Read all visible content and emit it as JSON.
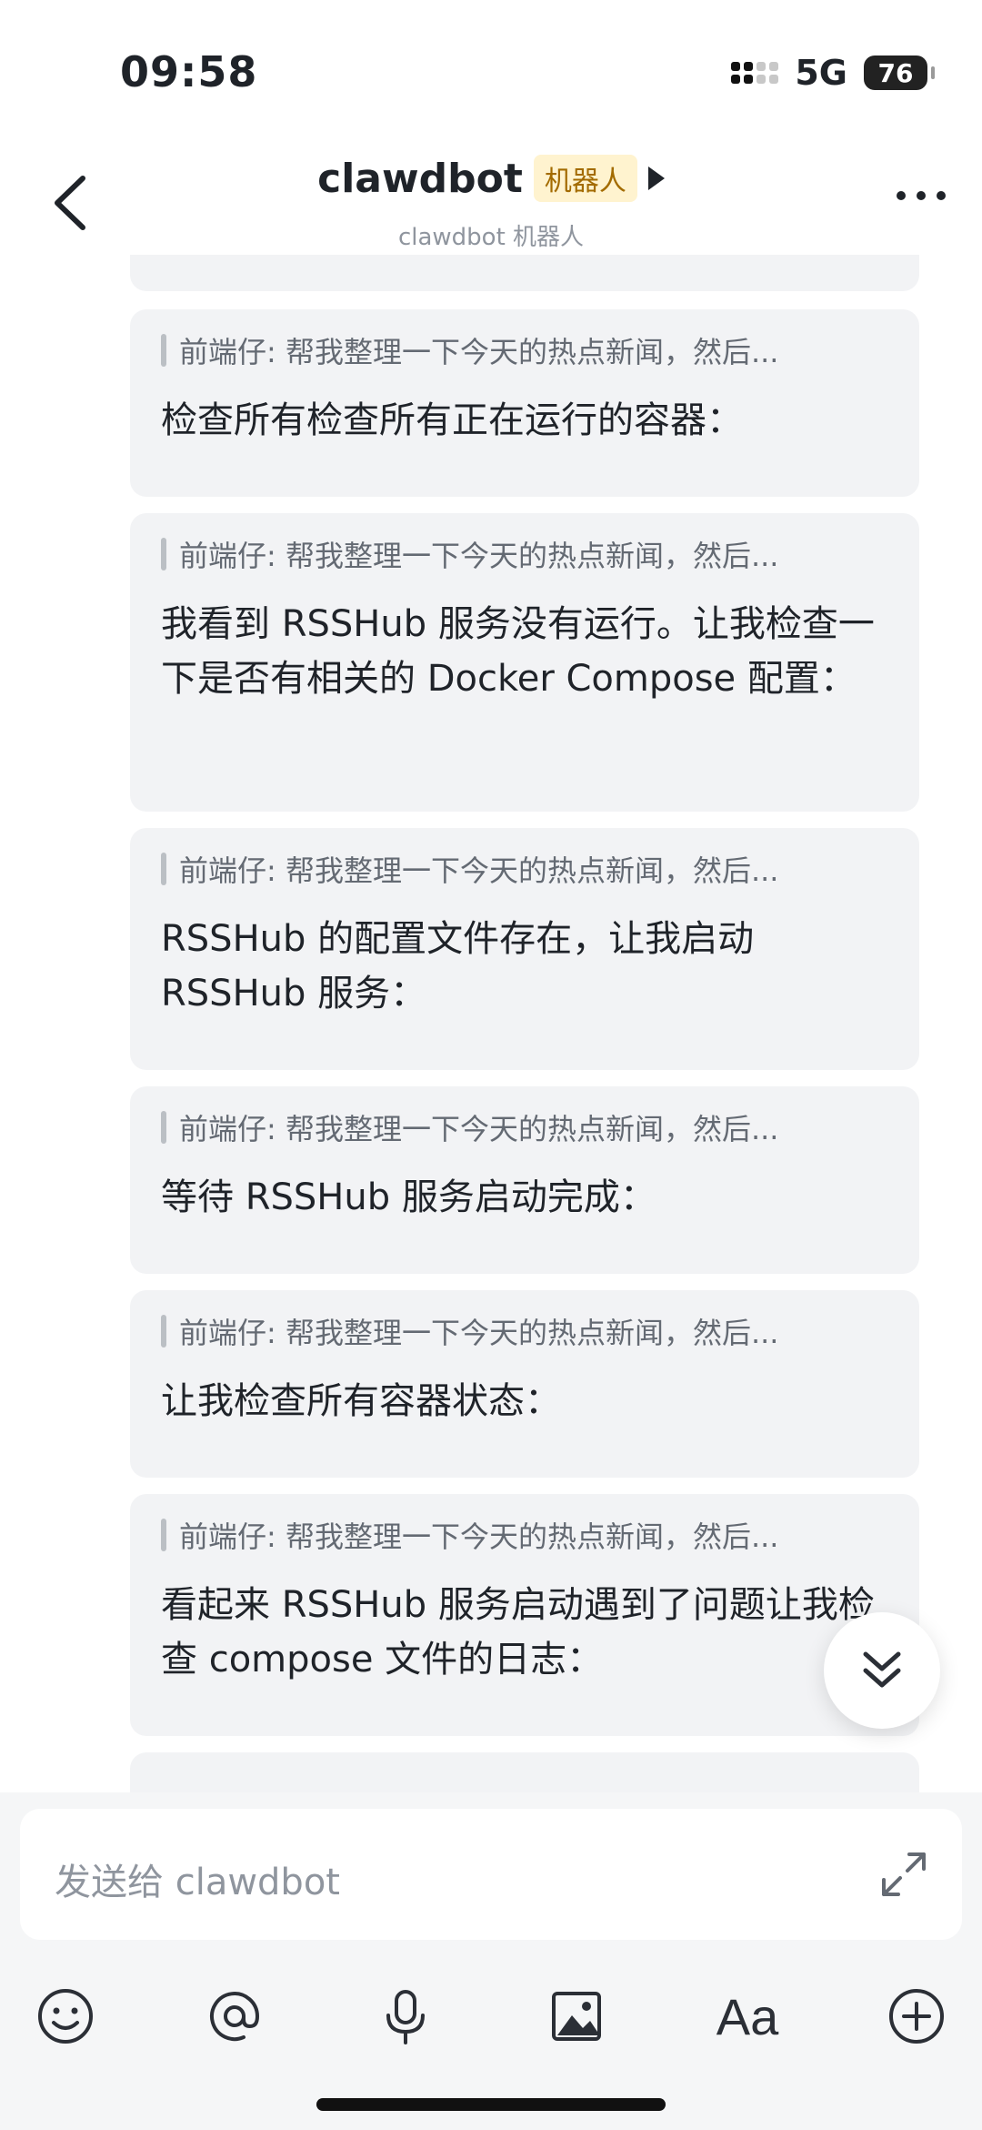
{
  "status": {
    "time": "09:58",
    "network": "5G",
    "battery": "76"
  },
  "header": {
    "title": "clawdbot",
    "badge": "机器人",
    "subtitle": "clawdbot 机器人"
  },
  "messages": [
    {
      "quote": "前端仔: 帮我整理一下今天的热点新闻，然后...",
      "text": "检查所有检查所有正在运行的容器："
    },
    {
      "quote": "前端仔: 帮我整理一下今天的热点新闻，然后...",
      "text": "我看到 RSSHub 服务没有运行。让我检查一下是否有相关的 Docker Compose 配置："
    },
    {
      "quote": "前端仔: 帮我整理一下今天的热点新闻，然后...",
      "text": "RSSHub 的配置文件存在，让我启动 RSSHub 服务："
    },
    {
      "quote": "前端仔: 帮我整理一下今天的热点新闻，然后...",
      "text": "等待 RSSHub 服务启动完成："
    },
    {
      "quote": "前端仔: 帮我整理一下今天的热点新闻，然后...",
      "text": "让我检查所有容器状态："
    },
    {
      "quote": "前端仔: 帮我整理一下今天的热点新闻，然后...",
      "text": "看起来 RSSHub 服务启动遇到了问题让我检查 compose 文件的日志："
    }
  ],
  "composer": {
    "placeholder": "发送给 clawdbot",
    "font_label": "Aa"
  },
  "icons": [
    "back-chevron-icon",
    "more-icon",
    "double-chevron-down-icon",
    "expand-icon",
    "emoji-icon",
    "at-icon",
    "microphone-icon",
    "image-icon",
    "font-icon",
    "add-icon"
  ]
}
